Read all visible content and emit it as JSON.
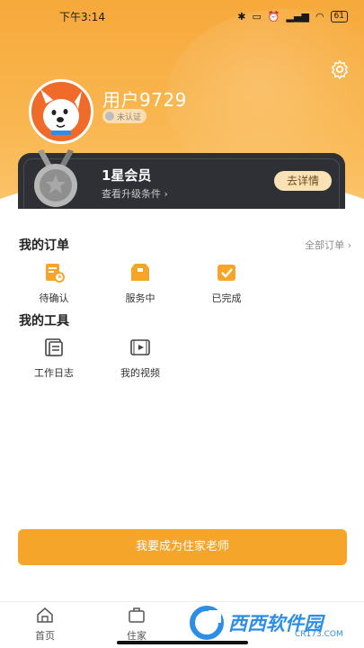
{
  "status_bar": {
    "time": "下午3:14",
    "battery": "61",
    "icons": [
      "bluetooth-icon",
      "vibrate-icon",
      "alarm-icon",
      "hd-signal-icon",
      "wifi-icon",
      "battery-icon"
    ]
  },
  "profile": {
    "username": "用户9729",
    "verify_status": "未认证",
    "avatar": "dog-avatar"
  },
  "member": {
    "title": "1星会员",
    "subtitle": "查看升级条件 ›",
    "detail_button": "去详情"
  },
  "orders": {
    "title": "我的订单",
    "all_link": "全部订单 ›",
    "items": [
      {
        "label": "待确认",
        "icon": "pending-icon"
      },
      {
        "label": "服务中",
        "icon": "in-service-icon"
      },
      {
        "label": "已完成",
        "icon": "completed-icon"
      }
    ]
  },
  "tools": {
    "title": "我的工具",
    "items": [
      {
        "label": "工作日志",
        "icon": "work-log-icon"
      },
      {
        "label": "我的视频",
        "icon": "video-icon"
      }
    ]
  },
  "cta": {
    "label": "我要成为住家老师"
  },
  "tabbar": {
    "tabs": [
      {
        "label": "首页",
        "icon": "home-icon"
      },
      {
        "label": "住家",
        "icon": "bag-icon"
      }
    ]
  },
  "watermark": {
    "brand": "西西软件园",
    "domain": "CR173.COM"
  },
  "colors": {
    "accent": "#f5a52a",
    "header_gradient_top": "#f7a93b",
    "member_card": "#2e3036",
    "detail_button_bg": "#fbe1b6"
  }
}
